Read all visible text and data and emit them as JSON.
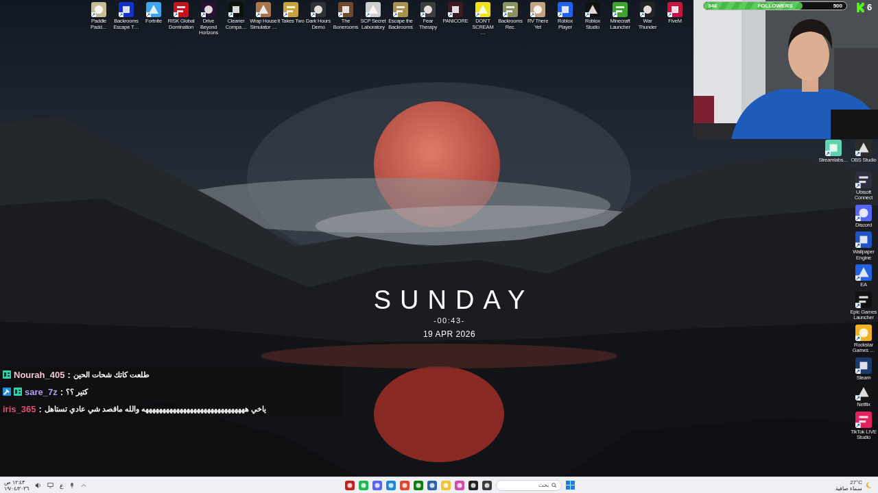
{
  "top_icons": [
    {
      "label": "Paddle Padd…",
      "color": "#c8bc98"
    },
    {
      "label": "Backrooms Escape T…",
      "color": "#1232c8"
    },
    {
      "label": "Fortnite",
      "color": "#3fa6ee"
    },
    {
      "label": "RISK Global Domination",
      "color": "#c4141e"
    },
    {
      "label": "Drive Beyond Horizons",
      "color": "#2a1032"
    },
    {
      "label": "Cleaner Compa…",
      "color": "#0b120b"
    },
    {
      "label": "Wrap House Simulator …",
      "color": "#a8764e"
    },
    {
      "label": "It Takes Two",
      "color": "#c8a23c"
    },
    {
      "label": "Dark Hours Demo",
      "color": "#303236"
    },
    {
      "label": "The Bonerooms",
      "color": "#6e4a30"
    },
    {
      "label": "SCP Secret Laboratory",
      "color": "#cfcfcf"
    },
    {
      "label": "Escape the Backrooms",
      "color": "#a89252"
    },
    {
      "label": "Fear Therapy",
      "color": "#3e3e3e"
    },
    {
      "label": "PANICORE",
      "color": "#3c1a22"
    },
    {
      "label": "DON'T SCREAM …",
      "color": "#f0e020"
    },
    {
      "label": "Backrooms Rec.",
      "color": "#8a9262"
    },
    {
      "label": "RV There Yet",
      "color": "#c2a282"
    },
    {
      "label": "Roblox Player",
      "color": "#2262f0"
    },
    {
      "label": "Roblox Studio",
      "color": "#121212"
    },
    {
      "label": "Minecraft Launcher",
      "color": "#3fa22e"
    },
    {
      "label": "War Thunder",
      "color": "#242424"
    },
    {
      "label": "FiveM",
      "color": "#c41442"
    }
  ],
  "stream_overlay": {
    "followers": {
      "current": "346",
      "label": "FOLLOWERS",
      "goal": "500",
      "level": 0.692
    },
    "viewer_count": "6"
  },
  "side_icons": [
    {
      "label": "Streamlabs…",
      "color": "#5fd2b2"
    },
    {
      "label": "OBS Studio",
      "color": "#2c2c2c"
    },
    {
      "label": "Ubisoft Connect",
      "color": "#2e2e3e"
    },
    {
      "label": "Discord",
      "color": "#5865f2"
    },
    {
      "label": "Wallpaper Engine",
      "color": "#2054c4"
    },
    {
      "label": "EA",
      "color": "#2462e2"
    },
    {
      "label": "Epic Games Launcher",
      "color": "#111111"
    },
    {
      "label": "Rockstar Games …",
      "color": "#f2b220"
    },
    {
      "label": "Steam",
      "color": "#1a3a6c"
    },
    {
      "label": "Netflix",
      "color": "#141414"
    },
    {
      "label": "TikTok LIVE Studio",
      "color": "#e2205c"
    }
  ],
  "clock": {
    "day": "SUNDAY",
    "time": "-00:43-",
    "date": "19 APR 2026"
  },
  "chat": [
    {
      "user": "Nourah_405",
      "color": "#f2c4d4",
      "badges": [
        {
          "kind": "subscriber"
        }
      ],
      "separator": ":",
      "message": "طلعت كاتك شحات الحين"
    },
    {
      "user": "sare_7z",
      "color": "#b49af2",
      "badges": [
        {
          "kind": "moderator"
        },
        {
          "kind": "subscriber"
        }
      ],
      "separator": ":",
      "message": "كتير ؟؟"
    },
    {
      "user": "iris_365",
      "color": "#e2506e",
      "separator": ":",
      "message": "ياخي ههههههههههههههههههههههههههههههه والله ماقصد شي عادي تستاهل"
    }
  ],
  "taskbar": {
    "time": "١٢:٤٣ ص",
    "date": "١٩/٠٤/٢٠٢٦",
    "language": "ع",
    "apps": [
      {
        "color": "#c42020"
      },
      {
        "color": "#1db954"
      },
      {
        "color": "#5865f2"
      },
      {
        "color": "#1f86d6"
      },
      {
        "color": "#e0452f"
      },
      {
        "color": "#107c10"
      },
      {
        "color": "#2a64a8"
      },
      {
        "color": "#f2c232"
      },
      {
        "color": "#d44aa8"
      },
      {
        "color": "#222222"
      },
      {
        "color": "#3a3a3a"
      }
    ],
    "search": {
      "placeholder": "بحث"
    },
    "weather": {
      "temperature": "27°C",
      "condition": "سماء صافية"
    }
  }
}
